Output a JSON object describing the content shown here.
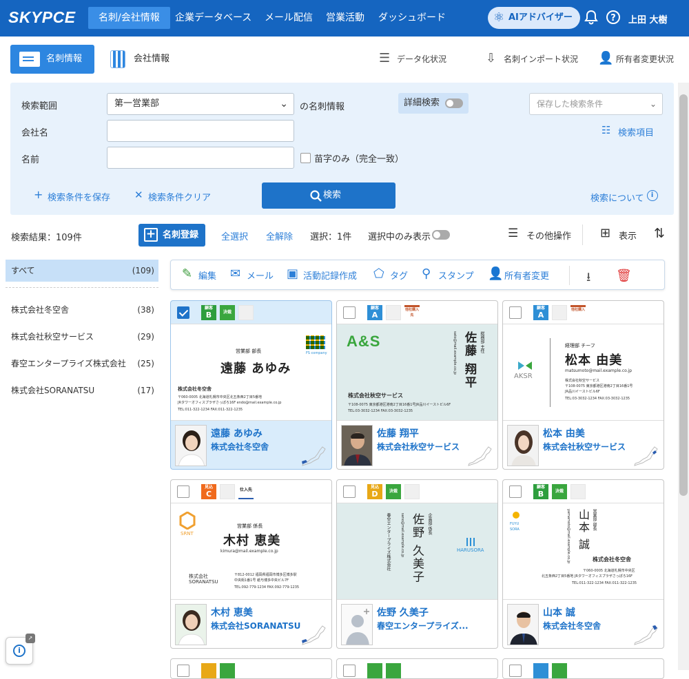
{
  "header": {
    "logo": "SKYPCE",
    "nav": [
      "名刺/会社情報",
      "企業データベース",
      "メール配信",
      "営業活動",
      "ダッシュボード"
    ],
    "ai_button": "AIアドバイザー",
    "user": "上田 大樹"
  },
  "subnav": {
    "tab_cards": "名刺情報",
    "tab_company": "会社情報",
    "status_data": "データ化状況",
    "status_import": "名刺インポート状況",
    "status_owner": "所有者変更状況"
  },
  "search": {
    "scope_label": "検索範囲",
    "scope_value": "第一営業部",
    "scope_suffix": "の名刺情報",
    "detail_toggle": "詳細検索",
    "saved_placeholder": "保存した検索条件",
    "company_label": "会社名",
    "name_label": "名前",
    "surname_only": "苗字のみ（完全一致）",
    "search_items": "検索項目",
    "save_conditions": "検索条件を保存",
    "clear_conditions": "検索条件クリア",
    "search_button": "検索",
    "about_search": "検索について"
  },
  "results": {
    "count_label": "検索結果：109件",
    "register_button": "名刺登録",
    "select_all": "全選択",
    "deselect_all": "全解除",
    "selected_count": "選択：1件",
    "show_selected_only": "選択中のみ表示",
    "other_ops": "その他操作",
    "view": "表示"
  },
  "sidebar": {
    "items": [
      {
        "label": "すべて",
        "count": "(109)"
      },
      {
        "label": "株式会社冬空舎",
        "count": "(38)"
      },
      {
        "label": "株式会社秋空サービス",
        "count": "(29)"
      },
      {
        "label": "春空エンタープライズ株式会社",
        "count": "(25)"
      },
      {
        "label": "株式会社SORANATSU",
        "count": "(17)"
      }
    ]
  },
  "toolbar": {
    "edit": "編集",
    "mail": "メール",
    "activity": "活動記録作成",
    "tag": "タグ",
    "stamp": "スタンプ",
    "owner_change": "所有者変更"
  },
  "cards": [
    {
      "name": "遠藤 あゆみ",
      "company": "株式会社冬空舎",
      "grade": "B",
      "grade_label": "顧客",
      "bc_title": "営業部 部長",
      "bc_company": "株式会社冬空舎",
      "bc_logo": "FS company",
      "bc_addr": "〒060-0005 北海道札幌市中央区北五条西2丁目5番地",
      "bc_addr2": "JRタワーオフィスプラザさっぽろ16F endo@mail.example.co.jp",
      "bc_tel": "TEL:011-322-1234 FAX:011-322-1235"
    },
    {
      "name": "佐藤 翔平",
      "company": "株式会社秋空サービス",
      "grade": "A",
      "grade_label": "顧客",
      "bc_title": "総務部 主任",
      "bc_company": "株式会社秋空サービス",
      "bc_logo": "A&S",
      "bc_addr": "〒108-0075 東京都港区港南2丁目16番1号JR品川イーストビル6F",
      "bc_tel": "TEL:03-3032-1234 FAX:03-3032-1235",
      "bc_mail": "sato@mail.example.co.jp"
    },
    {
      "name": "松本 由美",
      "company": "株式会社秋空サービス",
      "grade": "A",
      "grade_label": "顧客",
      "bc_title": "経理部 チーフ",
      "bc_company": "株式会社秋空サービス",
      "bc_logo": "AKSR",
      "bc_mail": "matsumoto@mail.example.co.jp",
      "bc_addr": "〒108-0075 東京都港区港南2丁目16番1号",
      "bc_addr2": "JR品川イーストビル6F",
      "bc_tel": "TEL:03-3032-1234 FAX:03-3032-1235"
    },
    {
      "name": "木村 恵美",
      "company": "株式会社SORANATSU",
      "grade": "C",
      "grade_label": "見込",
      "bc_title": "営業部 係長",
      "bc_company": "株式会社 SORANATSU",
      "bc_logo": "SRNT",
      "bc_mail": "kimura@mail.example.co.jp",
      "bc_addr": "〒812-0012 福岡県福岡市博多区博多駅",
      "bc_addr2": "中央街1番1号 紙与博多中央ビル7F",
      "bc_tel": "TEL:092-779-1234 FAX:092-779-1235"
    },
    {
      "name": "佐野 久美子",
      "company": "春空エンタープライズ...",
      "grade": "D",
      "grade_label": "見込",
      "bc_title": "企画部 係長",
      "bc_company": "春空エンタープライズ株式会社",
      "bc_logo": "HARUSORA",
      "bc_mail": "sano@mail.example.co.jp"
    },
    {
      "name": "山本 誠",
      "company": "株式会社冬空舎",
      "grade": "B",
      "grade_label": "顧客",
      "bc_title": "営業部 部長",
      "bc_company": "株式会社冬空舎",
      "bc_logo": "FUYU SORA",
      "bc_mail": "yamamoto@mail.example.co.jp",
      "bc_addr": "〒060-0005 北海道札幌市中央区",
      "bc_addr2": "北五条西2丁目5番地 JRタワーオフィスプラザさっぽろ16F",
      "bc_tel": "TEL:011-322-1234 FAX:011-322-1235"
    }
  ],
  "tags": {
    "c1": "決裁",
    "c2": "他社購入先",
    "c4": "仕入先",
    "approved": "決裁",
    "other": "他社購入"
  },
  "colors": {
    "primary": "#1565c0",
    "grade_A": "#2e8fd6",
    "grade_B": "#2e9e3e",
    "grade_C": "#f06a1d",
    "grade_D": "#e8a817",
    "tag_green": "#3aa63e",
    "tag_orange": "#c2542a"
  }
}
